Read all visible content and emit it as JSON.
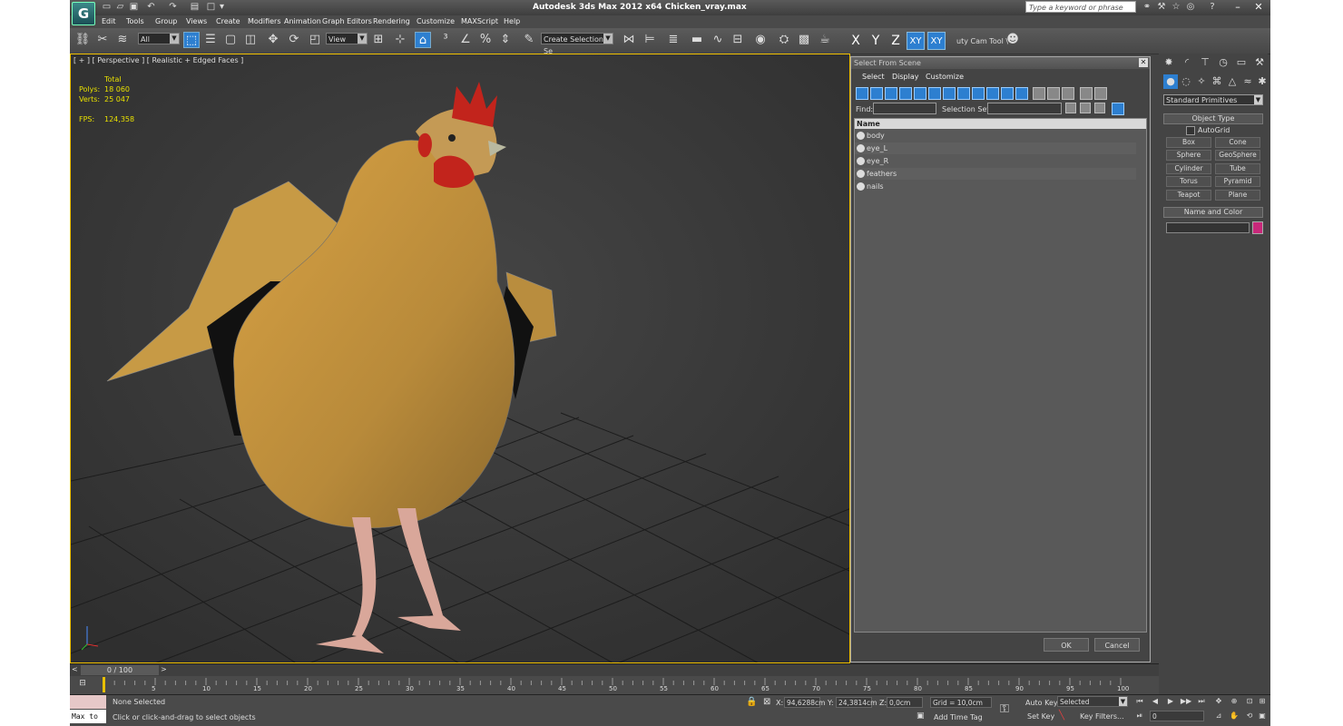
{
  "app": {
    "title": "Autodesk 3ds Max  2012 x64    Chicken_vray.max",
    "search_placeholder": "Type a keyword or phrase",
    "logo_text": "G"
  },
  "menu": [
    "Edit",
    "Tools",
    "Group",
    "Views",
    "Create",
    "Modifiers",
    "Animation",
    "Graph Editors",
    "Rendering",
    "Customize",
    "MAXScript",
    "Help"
  ],
  "toolbar": {
    "filter_value": "All",
    "coord_value": "View",
    "selection_set": "Create Selection Se",
    "axis_x": "X",
    "axis_y": "Y",
    "axis_z": "Z",
    "axis_xy": "XY",
    "axis_xy2": "XY",
    "cam_tool": "uty Cam Tool \\"
  },
  "viewport": {
    "label": "[ + ] [ Perspective ] [ Realistic + Edged Faces ]",
    "stats": {
      "total_label": "Total",
      "polys_label": "Polys:",
      "polys_value": "18 060",
      "verts_label": "Verts:",
      "verts_value": "25 047",
      "fps_label": "FPS:",
      "fps_value": "124,358"
    }
  },
  "dialog": {
    "title": "Select From Scene",
    "menus": [
      "Select",
      "Display",
      "Customize"
    ],
    "find_label": "Find:",
    "selset_label": "Selection Set:",
    "col_name": "Name",
    "items": [
      "body",
      "eye_L",
      "eye_R",
      "feathers",
      "nails"
    ],
    "ok": "OK",
    "cancel": "Cancel"
  },
  "command_panel": {
    "dropdown": "Standard Primitives",
    "object_type": "Object Type",
    "autogrid": "AutoGrid",
    "buttons": [
      "Box",
      "Cone",
      "Sphere",
      "GeoSphere",
      "Cylinder",
      "Tube",
      "Torus",
      "Pyramid",
      "Teapot",
      "Plane"
    ],
    "name_color": "Name and Color",
    "swatch_color": "#c8287a"
  },
  "timeline": {
    "slider": "0 / 100",
    "ticks": [
      "5",
      "10",
      "15",
      "20",
      "25",
      "30",
      "35",
      "40",
      "45",
      "50",
      "55",
      "60",
      "65",
      "70",
      "75",
      "80",
      "85",
      "90",
      "95",
      "100"
    ]
  },
  "status": {
    "maxscript": "Max to",
    "selected": "None Selected",
    "prompt": "Click or click-and-drag to select objects",
    "x_label": "X:",
    "x_value": "94,6288cm",
    "y_label": "Y:",
    "y_value": "24,3814cm",
    "z_label": "Z:",
    "z_value": "0,0cm",
    "grid": "Grid = 10,0cm",
    "add_time_tag": "Add Time Tag",
    "auto_key": "Auto Key",
    "set_key": "Set Key",
    "key_mode": "Selected",
    "key_filters": "Key Filters...",
    "frame": "0"
  }
}
